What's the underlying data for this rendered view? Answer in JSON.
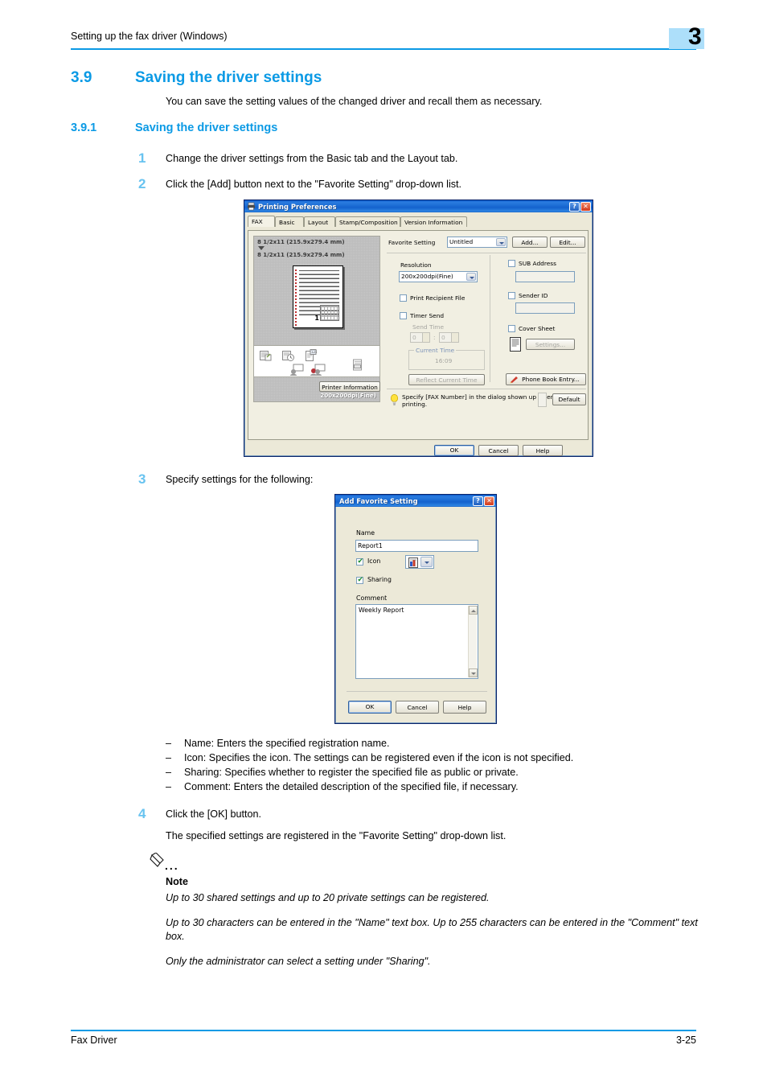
{
  "header": {
    "title": "Setting up the fax driver (Windows)",
    "chapter": "3"
  },
  "section": {
    "number": "3.9",
    "title": "Saving the driver settings",
    "intro": "You can save the setting values of the changed driver and recall them as necessary.",
    "sub_number": "3.9.1",
    "sub_title": "Saving the driver settings"
  },
  "steps": [
    {
      "num": "1",
      "text": "Change the driver settings from the Basic tab and the Layout tab."
    },
    {
      "num": "2",
      "text": "Click the [Add] button next to the \"Favorite Setting\" drop-down list."
    },
    {
      "num": "3",
      "text": "Specify settings for the following:"
    },
    {
      "num": "4",
      "text": "Click the [OK] button."
    }
  ],
  "step4_result": "The specified settings are registered in the \"Favorite Setting\" drop-down list.",
  "bullets": [
    {
      "dash": "–",
      "text": "Name: Enters the specified registration name."
    },
    {
      "dash": "–",
      "text": "Icon: Specifies the icon. The settings can be registered even if the icon is not specified."
    },
    {
      "dash": "–",
      "text": "Sharing: Specifies whether to register the specified file as public or private."
    },
    {
      "dash": "–",
      "text": "Comment: Enters the detailed description of the specified file, if necessary."
    }
  ],
  "note": {
    "dots": "...",
    "label": "Note",
    "lines": [
      "Up to 30 shared settings and up to 20 private settings can be registered.",
      "Up to 30 characters can be entered in the \"Name\" text box. Up to 255 characters can be entered in the \"Comment\" text box.",
      "Only the administrator can select a setting under \"Sharing\"."
    ]
  },
  "footer": {
    "left": "Fax Driver",
    "right": "3-25"
  },
  "printing_preferences": {
    "title": "Printing Preferences",
    "title_help": "?",
    "title_close": "✕",
    "tabs": [
      {
        "label": "FAX",
        "active": true
      },
      {
        "label": "Basic",
        "active": false
      },
      {
        "label": "Layout",
        "active": false
      },
      {
        "label": "Stamp/Composition",
        "active": false
      },
      {
        "label": "Version Information",
        "active": false
      }
    ],
    "preview": {
      "size_top": "8 1/2x11 (215.9x279.4 mm)",
      "size_bottom": "8 1/2x11 (215.9x279.4 mm)",
      "resolution_overlay": "200x200dpi(Fine)",
      "page_number": "1"
    },
    "printer_information_button": "Printer Information",
    "favorite_setting_label": "Favorite Setting",
    "favorite_setting_value": "Untitled",
    "add_button": "Add...",
    "edit_button": "Edit...",
    "resolution_label": "Resolution",
    "resolution_value": "200x200dpi(Fine)",
    "print_recipient_file_label": "Print Recipient File",
    "print_recipient_file_checked": false,
    "timer_send_label": "Timer Send",
    "timer_send_checked": false,
    "send_time_label": "Send Time",
    "send_time_hour": "0",
    "send_time_minute": "0",
    "send_time_separator": ":",
    "current_time_group": "Current Time",
    "current_time_value": "16:09",
    "reflect_current_time_button": "Reflect Current Time",
    "sub_address_label": "SUB Address",
    "sub_address_checked": false,
    "sub_address_value": "",
    "sender_id_label": "Sender ID",
    "sender_id_checked": false,
    "sender_id_value": "",
    "cover_sheet_label": "Cover Sheet",
    "cover_sheet_checked": false,
    "cover_sheet_settings_button": "Settings...",
    "phone_book_entry_button": "Phone Book Entry...",
    "hint_line1": "Specify [FAX Number] in the dialog shown up when",
    "hint_line2": "printing.",
    "default_button": "Default",
    "ok_button": "OK",
    "cancel_button": "Cancel",
    "help_button": "Help"
  },
  "add_favorite_setting": {
    "title": "Add Favorite Setting",
    "title_help": "?",
    "title_close": "✕",
    "name_label": "Name",
    "name_value": "Report1",
    "icon_label": "Icon",
    "icon_checked": true,
    "sharing_label": "Sharing",
    "sharing_checked": true,
    "comment_label": "Comment",
    "comment_value": "Weekly Report",
    "ok_button": "OK",
    "cancel_button": "Cancel",
    "help_button": "Help"
  },
  "colors": {
    "accent": "#0b9ae5",
    "step_number": "#68c3f0",
    "badge": "#addffa",
    "dialog_titlebar": "#1462cd"
  }
}
